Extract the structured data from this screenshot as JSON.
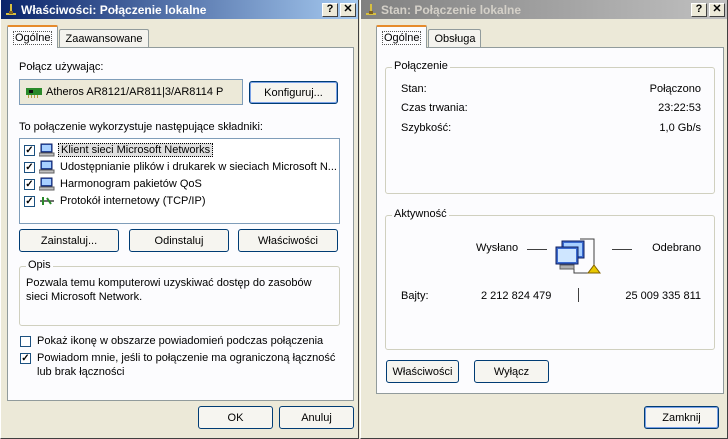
{
  "left_window": {
    "title": "Właściwości: Połączenie lokalne",
    "help_button": "?",
    "close_button": "✕",
    "tabs": [
      "Ogólne",
      "Zaawansowane"
    ],
    "connect_using_label": "Połącz używając:",
    "adapter_name": "Atheros AR8121/AR811|3/AR8114 P",
    "configure_button": "Konfiguruj...",
    "components_label": "To połączenie wykorzystuje następujące składniki:",
    "components": [
      {
        "label": "Klient sieci Microsoft Networks",
        "checked": true,
        "icon": "network-client-icon"
      },
      {
        "label": "Udostępnianie plików i drukarek w sieciach Microsoft N...",
        "checked": true,
        "icon": "file-sharing-icon"
      },
      {
        "label": "Harmonogram pakietów QoS",
        "checked": true,
        "icon": "qos-scheduler-icon"
      },
      {
        "label": "Protokół internetowy (TCP/IP)",
        "checked": true,
        "icon": "protocol-icon"
      }
    ],
    "install_button": "Zainstaluj...",
    "uninstall_button": "Odinstaluj",
    "properties_button": "Właściwości",
    "description_title": "Opis",
    "description_text_1": "Pozwala temu komputerowi uzyskiwać dostęp do zasobów",
    "description_text_2": "sieci Microsoft Network.",
    "show_icon_label": "Pokaż ikonę w obszarze powiadomień podczas połączenia",
    "show_icon_checked": false,
    "notify_label_1": "Powiadom mnie, jeśli to połączenie ma ograniczoną łączność",
    "notify_label_2": "lub brak łączności",
    "notify_checked": true,
    "ok_button": "OK",
    "cancel_button": "Anuluj"
  },
  "right_window": {
    "title": "Stan: Połączenie lokalne",
    "help_button": "?",
    "close_button": "✕",
    "tabs": [
      "Ogólne",
      "Obsługa"
    ],
    "connection_group": "Połączenie",
    "status_label": "Stan:",
    "status_value": "Połączono",
    "duration_label": "Czas trwania:",
    "duration_value": "23:22:53",
    "speed_label": "Szybkość:",
    "speed_value": "1,0 Gb/s",
    "activity_group": "Aktywność",
    "sent_label": "Wysłano",
    "received_label": "Odebrano",
    "bytes_label": "Bajty:",
    "bytes_sent": "2 212 824 479",
    "bytes_received": "25 009 335 811",
    "properties_button": "Właściwości",
    "disable_button": "Wyłącz",
    "close_window_button": "Zamknij"
  },
  "colors": {
    "active_title": "#0a246a",
    "inactive_title": "#808080",
    "dialog_bg": "#ece9d8",
    "tab_accent": "#e68b2c"
  }
}
